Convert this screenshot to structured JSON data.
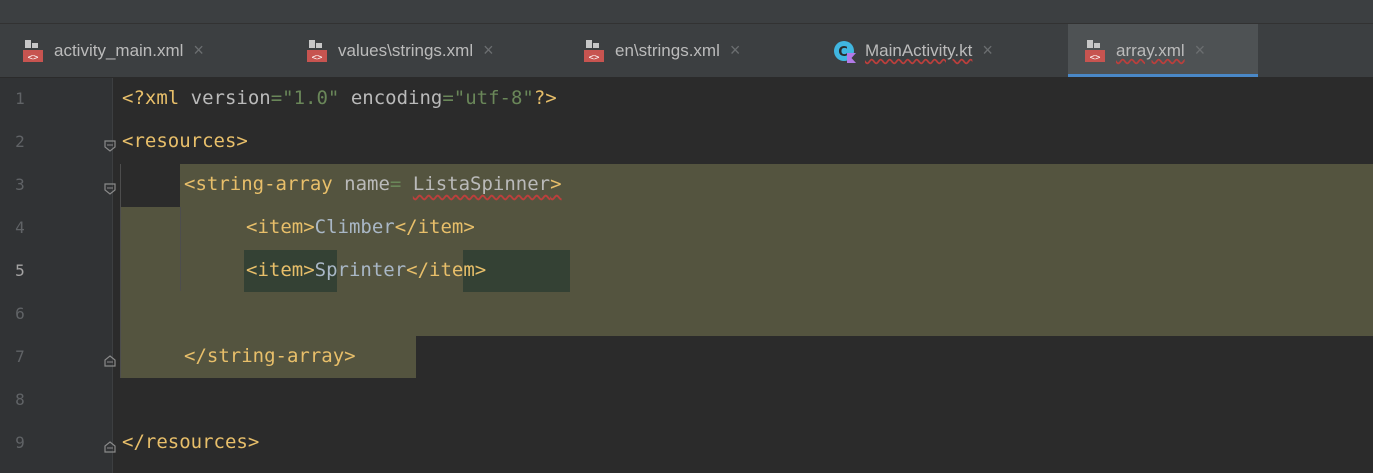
{
  "tabs": [
    {
      "label": "activity_main.xml",
      "close": "×",
      "icon": "xml-file-icon",
      "active": false
    },
    {
      "label": "values\\strings.xml",
      "close": "×",
      "icon": "xml-file-icon",
      "active": false
    },
    {
      "label": "en\\strings.xml",
      "close": "×",
      "icon": "xml-file-icon",
      "active": false
    },
    {
      "label": "MainActivity.kt",
      "close": "×",
      "icon": "kotlin-class-icon",
      "active": false
    },
    {
      "label": "array.xml",
      "close": "×",
      "icon": "xml-file-icon",
      "active": true
    }
  ],
  "editor": {
    "current_line": 5,
    "line_numbers": [
      "1",
      "2",
      "3",
      "4",
      "5",
      "6",
      "7",
      "8",
      "9"
    ],
    "lines": {
      "l1": {
        "open": "<?xml",
        "attr1": " version",
        "eq1": "=",
        "val1": "\"1.0\"",
        "attr2": " encoding",
        "eq2": "=",
        "val2": "\"utf-8\"",
        "close": "?>"
      },
      "l2": {
        "tag": "<resources>"
      },
      "l3": {
        "tag_open": "<string-array",
        "attr": " name",
        "eq": "=",
        "space": " ",
        "value": "ListaSpinner",
        "tag_close": ">"
      },
      "l4": {
        "open": "<item>",
        "text": "Climber",
        "close": "</item>"
      },
      "l5": {
        "open": "<item>",
        "text": "Sprinter",
        "close": "</item>"
      },
      "l7": {
        "tag": "</string-array>"
      },
      "l9": {
        "tag": "</resources>"
      }
    }
  },
  "colors": {
    "background": "#2b2b2b",
    "tag": "#e8bf6a",
    "string": "#6a8759",
    "selection": "#54543f",
    "active_tab_underline": "#4a88c7"
  }
}
